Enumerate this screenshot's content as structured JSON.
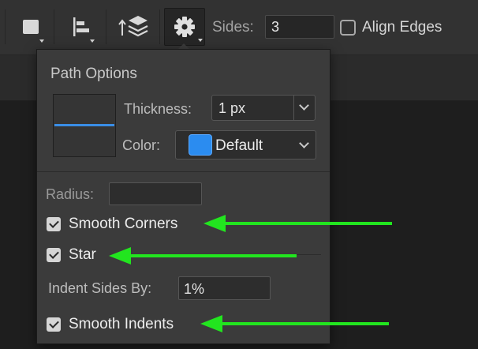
{
  "toolbar": {
    "shape_fill_icon": "square-swatch-icon",
    "align_icon": "path-alignment-icon",
    "arrange_icon": "path-arrangement-icon",
    "settings_icon": "gear-icon",
    "sides_label": "Sides:",
    "sides_value": "3",
    "align_edges_label": "Align Edges",
    "align_edges_checked": false
  },
  "popup": {
    "title": "Path Options",
    "thickness_label": "Thickness:",
    "thickness_value": "1 px",
    "color_label": "Color:",
    "color_value": "Default",
    "color_swatch": "#2b8cf0",
    "radius_label": "Radius:",
    "radius_value": "",
    "smooth_corners_label": "Smooth Corners",
    "smooth_corners_checked": true,
    "star_label": "Star",
    "star_checked": true,
    "indent_label": "Indent Sides By:",
    "indent_value": "1%",
    "smooth_indents_label": "Smooth Indents",
    "smooth_indents_checked": true
  },
  "colors": {
    "arrow": "#22e51f",
    "accent_line": "#3a8ee6"
  }
}
